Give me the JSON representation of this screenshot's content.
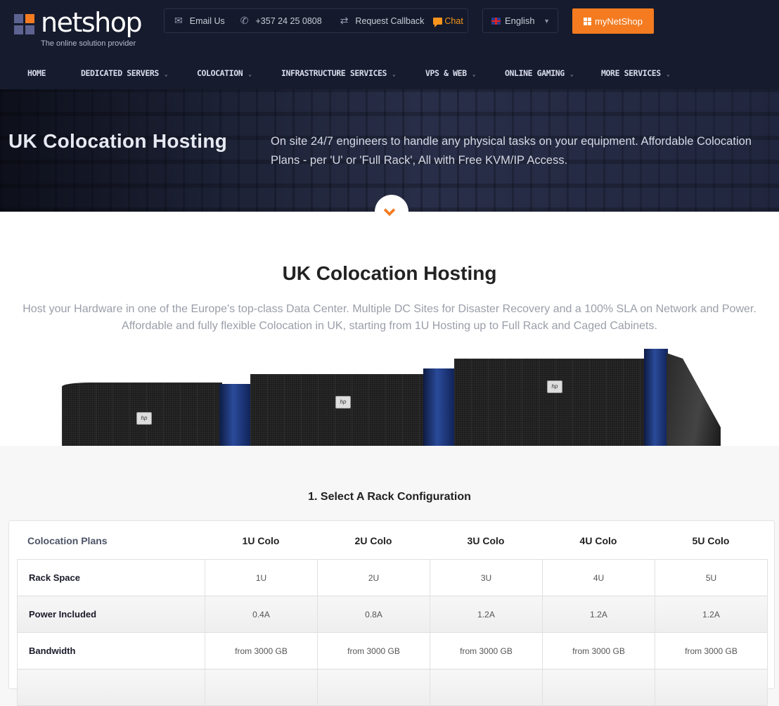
{
  "brand": {
    "name": "netshop",
    "tagline": "The online solution provider",
    "accent_color": "#f47b20"
  },
  "contact_bar": {
    "email_label": "Email Us",
    "email_icon": "envelope-icon",
    "phone_label": "+357 24 25 0808",
    "phone_icon": "phone-icon",
    "callback_label": "Request Callback",
    "callback_icon": "arrows-exchange-icon",
    "chat_label": "Chat",
    "chat_icon": "chat-bubble-icon"
  },
  "language": {
    "selected": "English",
    "flag": "uk-flag-icon"
  },
  "account_button": {
    "label": "myNetShop",
    "icon": "grid-icon"
  },
  "nav": {
    "items": [
      {
        "label": "HOME",
        "has_dropdown": false
      },
      {
        "label": "DEDICATED SERVERS",
        "has_dropdown": true
      },
      {
        "label": "COLOCATION",
        "has_dropdown": true
      },
      {
        "label": "INFRASTRUCTURE SERVICES",
        "has_dropdown": true
      },
      {
        "label": "VPS & WEB",
        "has_dropdown": true
      },
      {
        "label": "ONLINE GAMING",
        "has_dropdown": true
      },
      {
        "label": "MORE SERVICES",
        "has_dropdown": true
      }
    ],
    "chevron": "⌄"
  },
  "hero": {
    "title": "UK Colocation Hosting",
    "description": "On site 24/7 engineers to handle any physical tasks on your equipment. Affordable Colocation Plans - per 'U' or 'Full Rack', All with Free KVM/IP Access."
  },
  "intro": {
    "title": "UK Colocation Hosting",
    "line1": "Host your Hardware in one of the Europe's top-class Data Center. Multiple DC Sites for Disaster Recovery and a 100% SLA on Network and Power.",
    "line2": "Affordable and fully flexible Colocation in UK, starting from 1U Hosting up to Full Rack and Caged Cabinets.",
    "hp_badge": "hp"
  },
  "config": {
    "title": "1. Select A Rack Configuration",
    "table_label": "Colocation Plans",
    "plans": [
      "1U Colo",
      "2U Colo",
      "3U Colo",
      "4U Colo",
      "5U Colo"
    ],
    "rows": [
      {
        "label": "Rack Space",
        "values": [
          "1U",
          "2U",
          "3U",
          "4U",
          "5U"
        ]
      },
      {
        "label": "Power Included",
        "values": [
          "0.4A",
          "0.8A",
          "1.2A",
          "1.2A",
          "1.2A"
        ]
      },
      {
        "label": "Bandwidth",
        "values": [
          "from 3000 GB",
          "from 3000 GB",
          "from 3000 GB",
          "from 3000 GB",
          "from 3000 GB"
        ]
      }
    ]
  }
}
